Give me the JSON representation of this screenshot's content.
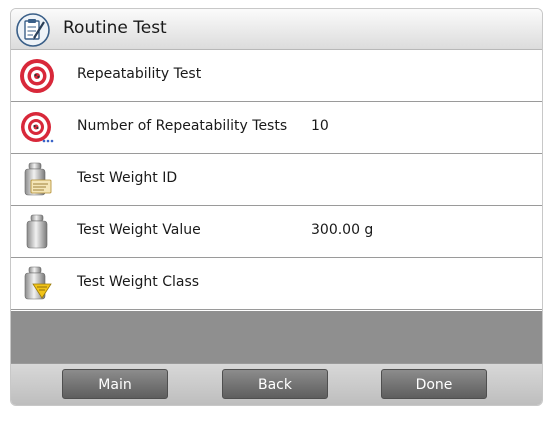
{
  "header": {
    "title": "Routine Test",
    "icon": "clipboard-pencil-icon"
  },
  "rows": [
    {
      "label": "Repeatability Test",
      "value": "",
      "icon": "target-icon"
    },
    {
      "label": "Number of Repeatability Tests",
      "value": "10",
      "icon": "target-count-icon"
    },
    {
      "label": "Test Weight ID",
      "value": "",
      "icon": "weight-id-icon"
    },
    {
      "label": "Test Weight Value",
      "value": "300.00 g",
      "icon": "weight-icon"
    },
    {
      "label": "Test Weight Class",
      "value": "",
      "icon": "weight-class-icon"
    }
  ],
  "buttons": {
    "main": "Main",
    "back": "Back",
    "done": "Done"
  },
  "colors": {
    "button": "#6e6e6e",
    "target_red": "#d8283a",
    "gray_area": "#8f8f8f"
  }
}
